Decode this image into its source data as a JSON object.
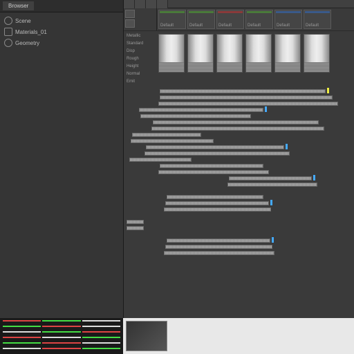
{
  "left": {
    "tab": "Browser",
    "items": [
      {
        "label": "Scene"
      },
      {
        "label": "Materials_01"
      },
      {
        "label": "Geometry"
      }
    ]
  },
  "toolbar": {
    "buttons": [
      "a",
      "b",
      "c",
      "d"
    ]
  },
  "tracks": {
    "heads": [
      {
        "label": "Default"
      },
      {
        "label": "Default"
      },
      {
        "label": "Default"
      },
      {
        "label": "Default"
      },
      {
        "label": "Default"
      },
      {
        "label": "Default"
      }
    ],
    "labels": [
      "Metallic",
      "Standard",
      "Disp",
      "Rough",
      "Height",
      "Normal",
      "Emit"
    ]
  }
}
